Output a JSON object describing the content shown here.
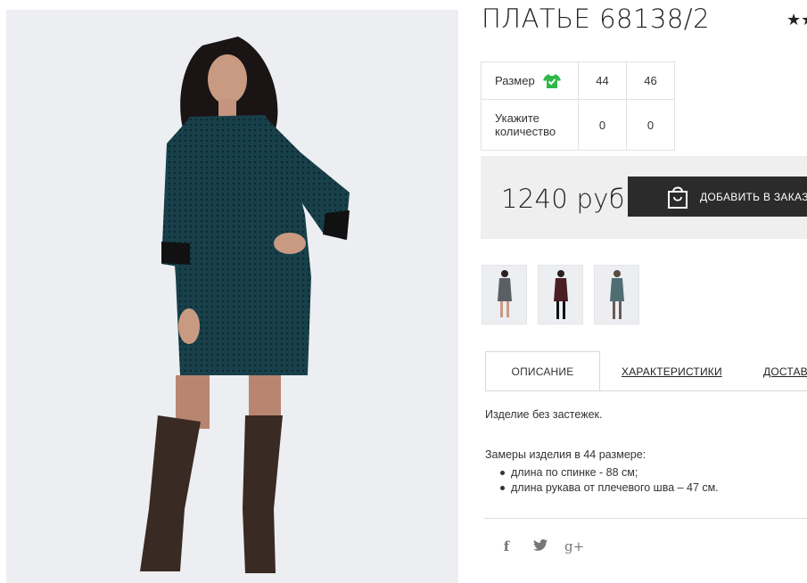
{
  "product": {
    "title": "ПЛАТЬЕ 68138/2",
    "rating_stars": "★★"
  },
  "sizes": {
    "row_label": "Размер",
    "qty_label": "Укажите количество",
    "options": [
      {
        "size": "44",
        "qty": "0"
      },
      {
        "size": "46",
        "qty": "0"
      }
    ]
  },
  "purchase": {
    "price": "1240 руб",
    "add_to_cart": "ДОБАВИТЬ В ЗАКАЗ"
  },
  "tabs": {
    "description": "ОПИСАНИЕ",
    "specs": "ХАРАКТЕРИСТИКИ",
    "delivery": "ДОСТАВКА"
  },
  "description": {
    "intro": "Изделие без застежек.",
    "measure_title": "Замеры изделия в 44 размере:",
    "items": [
      "длина по спинке - 88 см;",
      "длина рукава от плечевого шва – 47 см."
    ]
  },
  "social": {
    "facebook": "f",
    "twitter": "🐦",
    "google_plus": "g+"
  },
  "colors": {
    "accent_green": "#2fb84a",
    "button_dark": "#2b2b2b",
    "dress_teal": "#17404a"
  }
}
